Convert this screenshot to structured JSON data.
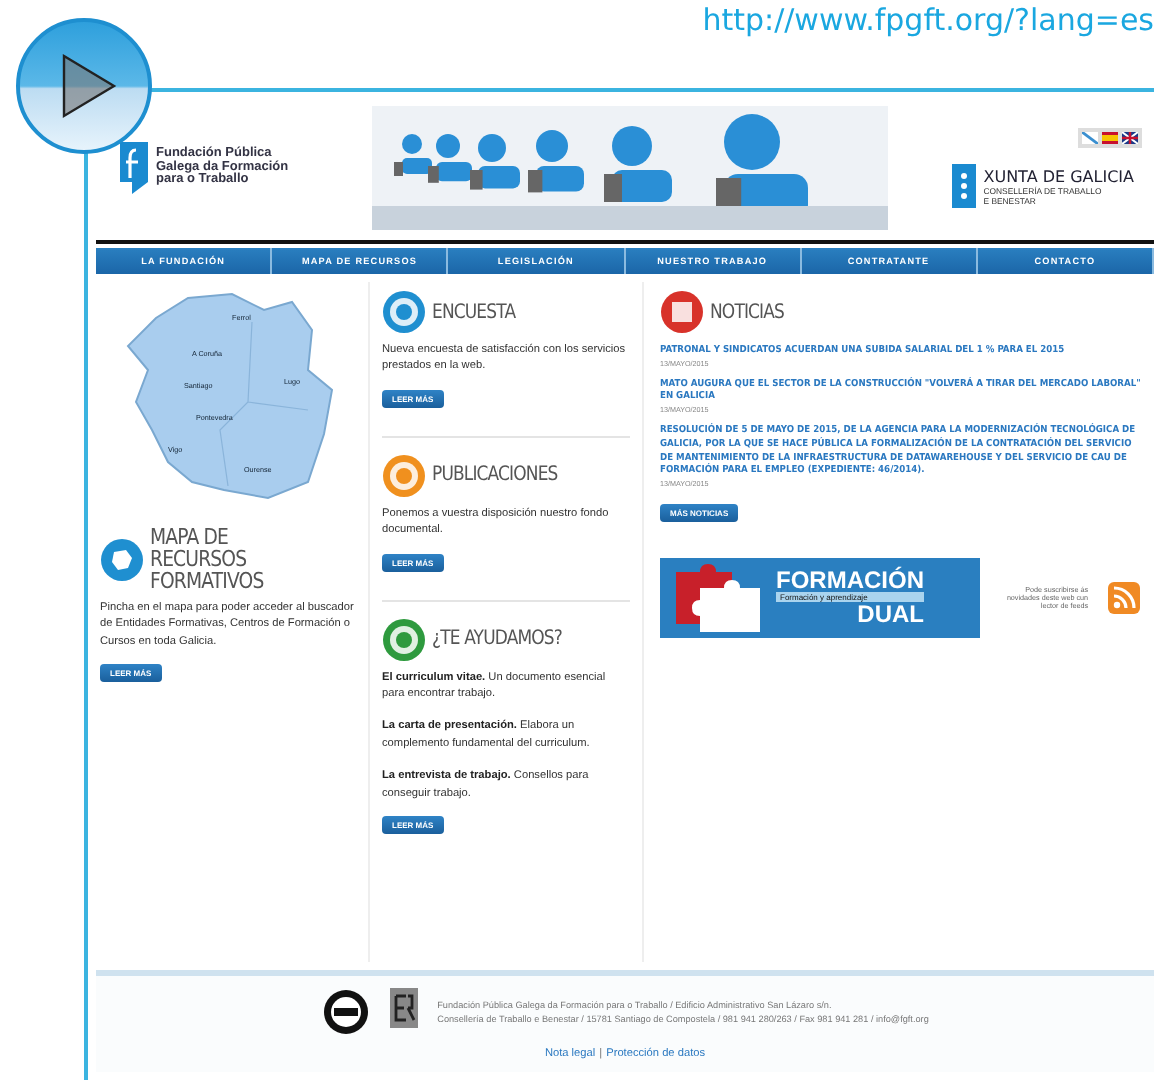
{
  "slide": {
    "url": "http://www.fpgft.org/?lang=es"
  },
  "header": {
    "logo_lines": [
      "Fundación Pública",
      "Galega da Formación",
      "para o Traballo"
    ],
    "xunta_title": "XUNTA DE GALICIA",
    "xunta_subtitle": [
      "CONSELLERÍA DE TRABALLO",
      "E BENESTAR"
    ]
  },
  "nav": [
    {
      "label": "LA FUNDACIÓN"
    },
    {
      "label": "MAPA DE RECURSOS"
    },
    {
      "label": "LEGISLACIÓN"
    },
    {
      "label": "NUESTRO TRABAJO"
    },
    {
      "label": "CONTRATANTE"
    },
    {
      "label": "CONTACTO"
    }
  ],
  "map": {
    "cities": [
      "Ferrol",
      "A Coruña",
      "Santiago",
      "Lugo",
      "Pontevedra",
      "Vigo",
      "Ourense"
    ]
  },
  "left": {
    "title": "MAPA DE RECURSOS FORMATIVOS",
    "text": "Pincha en el mapa para poder acceder al buscador de Entidades Formativas, Centros de Formación o Cursos en toda Galicia.",
    "button": "LEER MÁS"
  },
  "middle": [
    {
      "kind": "survey",
      "title": "ENCUESTA",
      "paragraphs": [
        "Nueva encuesta de satisfacción con los servicios prestados en la web."
      ],
      "button": "LEER MÁS"
    },
    {
      "kind": "publications",
      "title": "PUBLICACIONES",
      "paragraphs": [
        "Ponemos a vuestra disposición nuestro fondo documental."
      ],
      "button": "LEER MÁS"
    },
    {
      "kind": "help",
      "title": "¿TE AYUDAMOS?",
      "paragraphs": [
        "**El curriculum vitae.** Un documento esencial para encontrar trabajo.",
        "**La carta de presentación.** Elabora un complemento fundamental del curriculum.",
        "**La entrevista de trabajo.** Consellos para conseguir trabajo."
      ],
      "button": "LEER MÁS"
    }
  ],
  "news": {
    "title": "NOTICIAS",
    "items": [
      {
        "headline": "PATRONAL Y SINDICATOS ACUERDAN UNA SUBIDA SALARIAL DEL 1 % PARA EL 2015",
        "date": "13/MAYO/2015"
      },
      {
        "headline": "MATO AUGURA QUE EL SECTOR DE LA CONSTRUCCIÓN \"VOLVERÁ A TIRAR DEL MERCADO LABORAL\" EN GALICIA",
        "date": "13/MAYO/2015"
      },
      {
        "headline": "RESOLUCIÓN DE 5 DE MAYO DE 2015, DE LA AGENCIA PARA LA MODERNIZACIÓN TECNOLÓGICA DE GALICIA, POR LA QUE SE HACE PÚBLICA LA FORMALIZACIÓN DE LA CONTRATACIÓN DEL SERVICIO DE MANTENIMIENTO DE LA INFRAESTRUCTURA DE DATAWAREHOUSE Y DEL SERVICIO DE CAU DE FORMACIÓN PARA EL EMPLEO (EXPEDIENTE: 46/2014).",
        "date": "13/MAYO/2015"
      }
    ],
    "button": "MÁS NOTICIAS"
  },
  "dual_banner": {
    "title": "FORMACIÓN",
    "subtitle": "DUAL",
    "tagline": "Formación y aprendizaje"
  },
  "rss": {
    "text": "Pode suscribirse ás novidades deste web cun lector de feeds"
  },
  "footer": {
    "address": [
      "Fundación Pública Galega da Formación para o Traballo / Edificio Administrativo San Lázaro s/n.",
      "Consellería de Traballo e Benestar / 15781 Santiago de Compostela / 981 941 280/263 / Fax 981 941 281 / info@fgft.org"
    ],
    "links": [
      "Nota legal",
      "Protección de datos"
    ],
    "separator": "|"
  }
}
